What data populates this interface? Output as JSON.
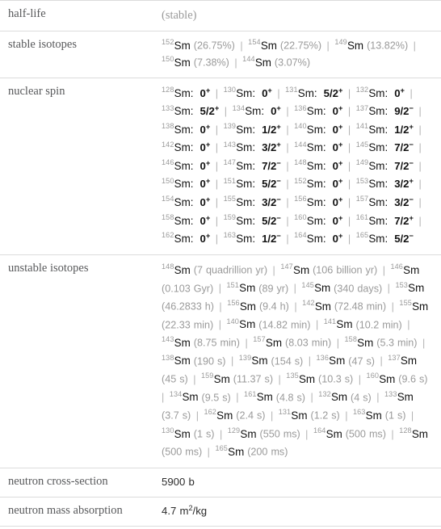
{
  "table": {
    "rows": [
      {
        "label": "half-life",
        "kind": "muted",
        "value": "(stable)"
      },
      {
        "label": "stable isotopes",
        "kind": "isotope_abundance"
      },
      {
        "label": "nuclear spin",
        "kind": "isotope_spin"
      },
      {
        "label": "unstable isotopes",
        "kind": "isotope_halflife"
      },
      {
        "label": "neutron cross-section",
        "kind": "plain",
        "value": "5900 b"
      },
      {
        "label": "neutron mass absorption",
        "kind": "plain_sup",
        "value_pre": "4.7 m",
        "value_sup": "2",
        "value_post": "/kg"
      }
    ]
  },
  "element_symbol": "Sm",
  "stable_isotopes": [
    {
      "mass": "152",
      "symbol": "Sm",
      "detail": "(26.75%)"
    },
    {
      "mass": "154",
      "symbol": "Sm",
      "detail": "(22.75%)"
    },
    {
      "mass": "149",
      "symbol": "Sm",
      "detail": "(13.82%)"
    },
    {
      "mass": "150",
      "symbol": "Sm",
      "detail": "(7.38%)"
    },
    {
      "mass": "144",
      "symbol": "Sm",
      "detail": "(3.07%)"
    }
  ],
  "nuclear_spin": [
    {
      "mass": "128",
      "symbol": "Sm",
      "value": "0",
      "sign": "+"
    },
    {
      "mass": "130",
      "symbol": "Sm",
      "value": "0",
      "sign": "+"
    },
    {
      "mass": "131",
      "symbol": "Sm",
      "value": "5/2",
      "sign": "+"
    },
    {
      "mass": "132",
      "symbol": "Sm",
      "value": "0",
      "sign": "+"
    },
    {
      "mass": "133",
      "symbol": "Sm",
      "value": "5/2",
      "sign": "+"
    },
    {
      "mass": "134",
      "symbol": "Sm",
      "value": "0",
      "sign": "+"
    },
    {
      "mass": "136",
      "symbol": "Sm",
      "value": "0",
      "sign": "+"
    },
    {
      "mass": "137",
      "symbol": "Sm",
      "value": "9/2",
      "sign": "−"
    },
    {
      "mass": "138",
      "symbol": "Sm",
      "value": "0",
      "sign": "+"
    },
    {
      "mass": "139",
      "symbol": "Sm",
      "value": "1/2",
      "sign": "+"
    },
    {
      "mass": "140",
      "symbol": "Sm",
      "value": "0",
      "sign": "+"
    },
    {
      "mass": "141",
      "symbol": "Sm",
      "value": "1/2",
      "sign": "+"
    },
    {
      "mass": "142",
      "symbol": "Sm",
      "value": "0",
      "sign": "+"
    },
    {
      "mass": "143",
      "symbol": "Sm",
      "value": "3/2",
      "sign": "+"
    },
    {
      "mass": "144",
      "symbol": "Sm",
      "value": "0",
      "sign": "+"
    },
    {
      "mass": "145",
      "symbol": "Sm",
      "value": "7/2",
      "sign": "−"
    },
    {
      "mass": "146",
      "symbol": "Sm",
      "value": "0",
      "sign": "+"
    },
    {
      "mass": "147",
      "symbol": "Sm",
      "value": "7/2",
      "sign": "−"
    },
    {
      "mass": "148",
      "symbol": "Sm",
      "value": "0",
      "sign": "+"
    },
    {
      "mass": "149",
      "symbol": "Sm",
      "value": "7/2",
      "sign": "−"
    },
    {
      "mass": "150",
      "symbol": "Sm",
      "value": "0",
      "sign": "+"
    },
    {
      "mass": "151",
      "symbol": "Sm",
      "value": "5/2",
      "sign": "−"
    },
    {
      "mass": "152",
      "symbol": "Sm",
      "value": "0",
      "sign": "+"
    },
    {
      "mass": "153",
      "symbol": "Sm",
      "value": "3/2",
      "sign": "+"
    },
    {
      "mass": "154",
      "symbol": "Sm",
      "value": "0",
      "sign": "+"
    },
    {
      "mass": "155",
      "symbol": "Sm",
      "value": "3/2",
      "sign": "−"
    },
    {
      "mass": "156",
      "symbol": "Sm",
      "value": "0",
      "sign": "+"
    },
    {
      "mass": "157",
      "symbol": "Sm",
      "value": "3/2",
      "sign": "−"
    },
    {
      "mass": "158",
      "symbol": "Sm",
      "value": "0",
      "sign": "+"
    },
    {
      "mass": "159",
      "symbol": "Sm",
      "value": "5/2",
      "sign": "−"
    },
    {
      "mass": "160",
      "symbol": "Sm",
      "value": "0",
      "sign": "+"
    },
    {
      "mass": "161",
      "symbol": "Sm",
      "value": "7/2",
      "sign": "+"
    },
    {
      "mass": "162",
      "symbol": "Sm",
      "value": "0",
      "sign": "+"
    },
    {
      "mass": "163",
      "symbol": "Sm",
      "value": "1/2",
      "sign": "−"
    },
    {
      "mass": "164",
      "symbol": "Sm",
      "value": "0",
      "sign": "+"
    },
    {
      "mass": "165",
      "symbol": "Sm",
      "value": "5/2",
      "sign": "−"
    }
  ],
  "unstable_isotopes": [
    {
      "mass": "148",
      "symbol": "Sm",
      "detail": "(7 quadrillion yr)"
    },
    {
      "mass": "147",
      "symbol": "Sm",
      "detail": "(106 billion yr)"
    },
    {
      "mass": "146",
      "symbol": "Sm",
      "detail": "(0.103 Gyr)"
    },
    {
      "mass": "151",
      "symbol": "Sm",
      "detail": "(89 yr)"
    },
    {
      "mass": "145",
      "symbol": "Sm",
      "detail": "(340 days)"
    },
    {
      "mass": "153",
      "symbol": "Sm",
      "detail": "(46.2833 h)"
    },
    {
      "mass": "156",
      "symbol": "Sm",
      "detail": "(9.4 h)"
    },
    {
      "mass": "142",
      "symbol": "Sm",
      "detail": "(72.48 min)"
    },
    {
      "mass": "155",
      "symbol": "Sm",
      "detail": "(22.33 min)"
    },
    {
      "mass": "140",
      "symbol": "Sm",
      "detail": "(14.82 min)"
    },
    {
      "mass": "141",
      "symbol": "Sm",
      "detail": "(10.2 min)"
    },
    {
      "mass": "143",
      "symbol": "Sm",
      "detail": "(8.75 min)"
    },
    {
      "mass": "157",
      "symbol": "Sm",
      "detail": "(8.03 min)"
    },
    {
      "mass": "158",
      "symbol": "Sm",
      "detail": "(5.3 min)"
    },
    {
      "mass": "138",
      "symbol": "Sm",
      "detail": "(190 s)"
    },
    {
      "mass": "139",
      "symbol": "Sm",
      "detail": "(154 s)"
    },
    {
      "mass": "136",
      "symbol": "Sm",
      "detail": "(47 s)"
    },
    {
      "mass": "137",
      "symbol": "Sm",
      "detail": "(45 s)"
    },
    {
      "mass": "159",
      "symbol": "Sm",
      "detail": "(11.37 s)"
    },
    {
      "mass": "135",
      "symbol": "Sm",
      "detail": "(10.3 s)"
    },
    {
      "mass": "160",
      "symbol": "Sm",
      "detail": "(9.6 s)"
    },
    {
      "mass": "134",
      "symbol": "Sm",
      "detail": "(9.5 s)"
    },
    {
      "mass": "161",
      "symbol": "Sm",
      "detail": "(4.8 s)"
    },
    {
      "mass": "132",
      "symbol": "Sm",
      "detail": "(4 s)"
    },
    {
      "mass": "133",
      "symbol": "Sm",
      "detail": "(3.7 s)"
    },
    {
      "mass": "162",
      "symbol": "Sm",
      "detail": "(2.4 s)"
    },
    {
      "mass": "131",
      "symbol": "Sm",
      "detail": "(1.2 s)"
    },
    {
      "mass": "163",
      "symbol": "Sm",
      "detail": "(1 s)"
    },
    {
      "mass": "130",
      "symbol": "Sm",
      "detail": "(1 s)"
    },
    {
      "mass": "129",
      "symbol": "Sm",
      "detail": "(550 ms)"
    },
    {
      "mass": "164",
      "symbol": "Sm",
      "detail": "(500 ms)"
    },
    {
      "mass": "128",
      "symbol": "Sm",
      "detail": "(500 ms)"
    },
    {
      "mass": "165",
      "symbol": "Sm",
      "detail": "(200 ms)"
    }
  ],
  "separator": "|",
  "colors": {
    "border": "#dcdcdc",
    "label_text": "#58595b",
    "muted_text": "#9a9a9a",
    "primary_text": "#111111"
  }
}
